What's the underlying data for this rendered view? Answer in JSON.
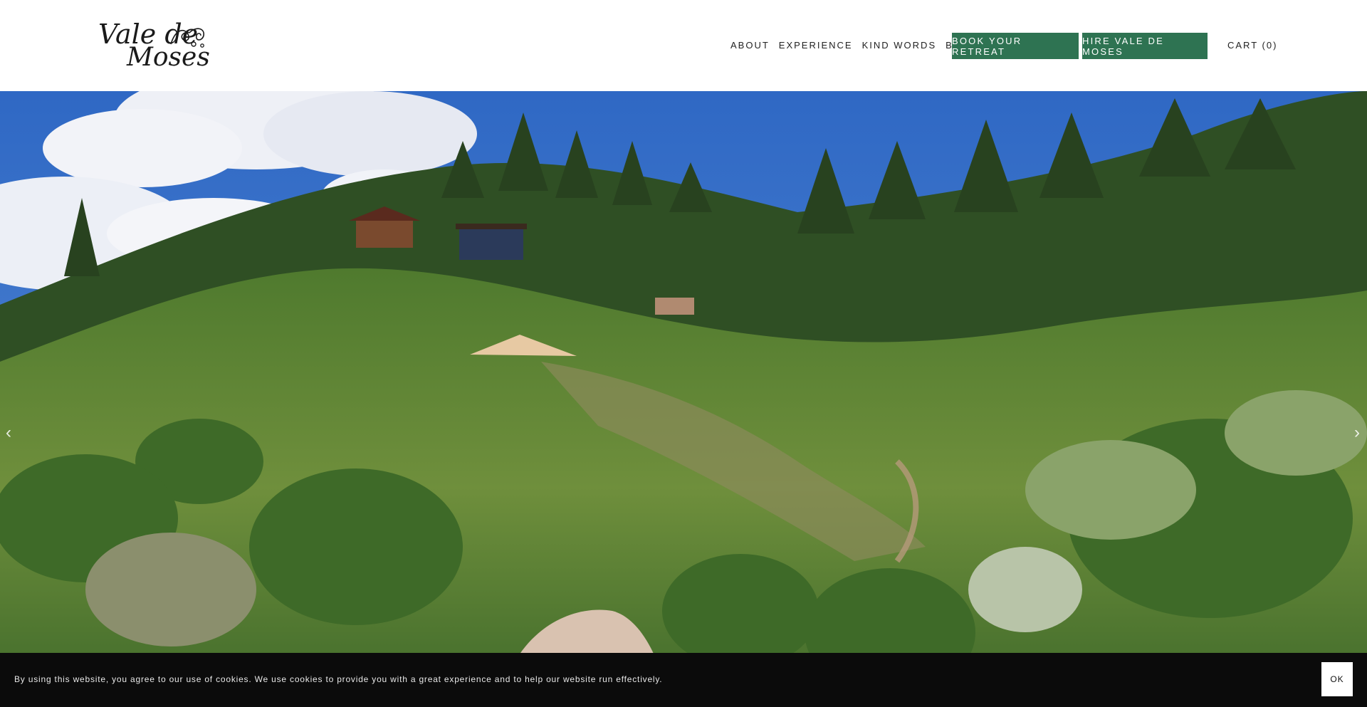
{
  "header": {
    "logo": {
      "line1": "Vale de",
      "line2": "Moses"
    },
    "nav": [
      {
        "label": "About"
      },
      {
        "label": "Experience"
      },
      {
        "label": "Kind Words"
      },
      {
        "label": "Blog"
      }
    ],
    "book_button": "Book Your Retreat",
    "hire_button": "Hire Vale De Moses",
    "cart": "Cart (0)"
  },
  "hero": {
    "prev_icon": "chevron-left-icon",
    "next_icon": "chevron-right-icon",
    "prev_glyph": "‹",
    "next_glyph": "›"
  },
  "cookie_bar": {
    "text": "By using this website, you agree to our use of cookies. We use cookies to provide you with a great experience and to help our website run effectively.",
    "ok_label": "OK"
  },
  "colors": {
    "accent_green": "#2e7352",
    "sky_blue": "#3d73c9",
    "cookie_bg": "#0b0b0b"
  }
}
